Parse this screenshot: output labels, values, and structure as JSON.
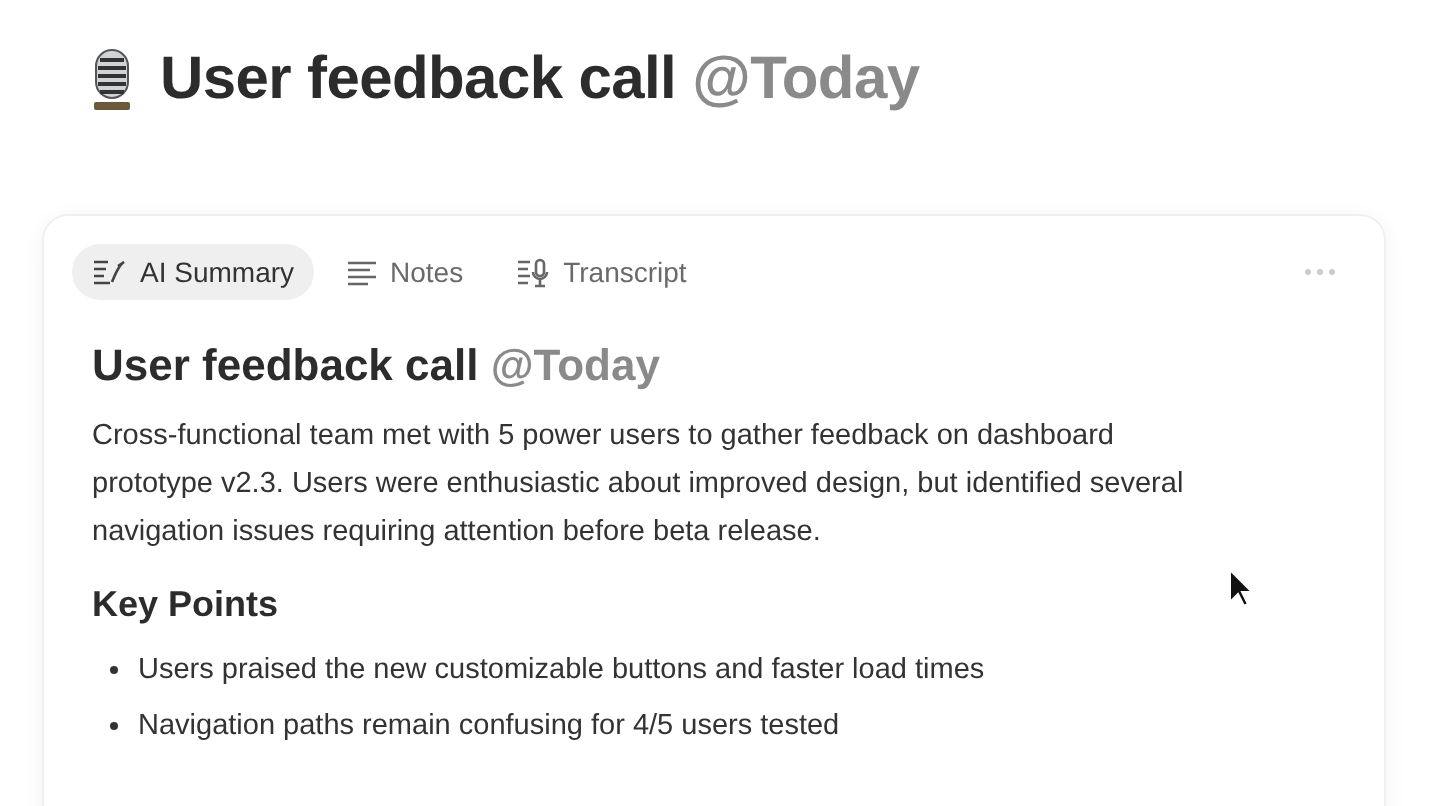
{
  "page": {
    "title": "User feedback call",
    "mention": "@Today"
  },
  "tabs": [
    {
      "label": "AI Summary",
      "kind": "summary",
      "selected": true
    },
    {
      "label": "Notes",
      "kind": "notes",
      "selected": false
    },
    {
      "label": "Transcript",
      "kind": "transcript",
      "selected": false
    }
  ],
  "summary": {
    "title": "User feedback call",
    "mention": "@Today",
    "text": "Cross-functional team met with 5 power users to gather feedback on dashboard prototype v2.3. Users were enthusiastic about improved design, but identified several navigation issues requiring attention before beta release.",
    "section_title": "Key Points",
    "points": [
      "Users praised the new customizable buttons and faster load times",
      "Navigation paths remain confusing for 4/5 users tested"
    ]
  }
}
